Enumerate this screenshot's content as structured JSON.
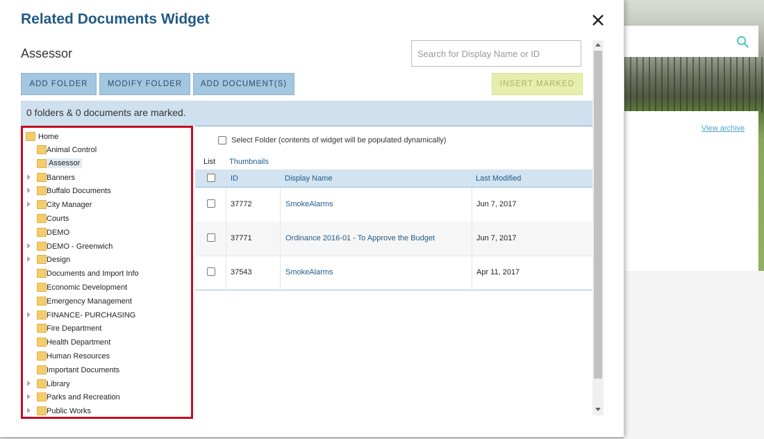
{
  "background": {
    "view_archive": "View archive"
  },
  "modal": {
    "title": "Related Documents Widget",
    "current_folder": "Assessor",
    "search_placeholder": "Search for Display Name or ID",
    "buttons": {
      "add_folder": "ADD FOLDER",
      "modify_folder": "MODIFY FOLDER",
      "add_documents": "ADD DOCUMENT(S)",
      "insert_marked": "INSERT MARKED"
    },
    "status": "0 folders & 0 documents are marked.",
    "tree": {
      "root": "Home",
      "items": [
        {
          "label": "Animal Control",
          "expandable": false
        },
        {
          "label": "Assessor",
          "expandable": false,
          "selected": true
        },
        {
          "label": "Banners",
          "expandable": true
        },
        {
          "label": "Buffalo Documents",
          "expandable": true
        },
        {
          "label": "City Manager",
          "expandable": true
        },
        {
          "label": "Courts",
          "expandable": false
        },
        {
          "label": "DEMO",
          "expandable": false
        },
        {
          "label": "DEMO - Greenwich",
          "expandable": true
        },
        {
          "label": "Design",
          "expandable": true
        },
        {
          "label": "Documents and Import Info",
          "expandable": false
        },
        {
          "label": "Economic Development",
          "expandable": false
        },
        {
          "label": "Emergency Management",
          "expandable": false
        },
        {
          "label": "FINANCE- PURCHASING",
          "expandable": true
        },
        {
          "label": "Fire Department",
          "expandable": false
        },
        {
          "label": "Health Department",
          "expandable": false
        },
        {
          "label": "Human Resources",
          "expandable": false
        },
        {
          "label": "Important Documents",
          "expandable": false
        },
        {
          "label": "Library",
          "expandable": true
        },
        {
          "label": "Parks and Recreation",
          "expandable": true
        },
        {
          "label": "Public Works",
          "expandable": true
        }
      ]
    },
    "select_folder_label": "Select Folder (contents of widget will be populated dynamically)",
    "tabs": {
      "list": "List",
      "thumbnails": "Thumbnails"
    },
    "table": {
      "headers": {
        "id": "ID",
        "display_name": "Display Name",
        "last_modified": "Last Modified"
      },
      "rows": [
        {
          "id": "37772",
          "name": "SmokeAlarms",
          "modified": "Jun 7, 2017"
        },
        {
          "id": "37771",
          "name": "Ordinance 2016-01 - To Approve the Budget",
          "modified": "Jun 7, 2017"
        },
        {
          "id": "37543",
          "name": "SmokeAlarms",
          "modified": "Apr 11, 2017"
        }
      ]
    }
  }
}
